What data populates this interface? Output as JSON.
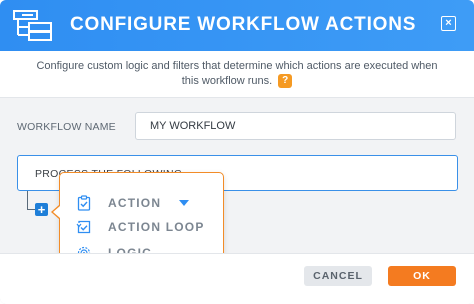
{
  "dialog": {
    "title": "CONFIGURE WORKFLOW ACTIONS",
    "header_icon": "workflow-icon",
    "close_icon": "close-icon",
    "close_symbol": "×"
  },
  "description": {
    "line1": "Configure custom logic and filters that determine which actions are executed when",
    "line2": "this workflow runs.",
    "help_symbol": "?"
  },
  "form": {
    "workflow_name_label": "WORKFLOW NAME",
    "workflow_name_value": "MY WORKFLOW"
  },
  "process": {
    "label": "PROCESS THE FOLLOWING",
    "add_symbol": "+"
  },
  "menu": {
    "items": [
      {
        "label": "ACTION",
        "icon": "clipboard-check-icon"
      },
      {
        "label": "ACTION LOOP",
        "icon": "loop-check-icon"
      },
      {
        "label": "LOGIC",
        "icon": "logic-gear-icon"
      }
    ]
  },
  "footer": {
    "cancel_label": "CANCEL",
    "ok_label": "OK"
  },
  "colors": {
    "header_blue": "#2f8ef2",
    "accent_orange": "#f28c28",
    "ok_orange": "#f47b20",
    "help_orange": "#f59a23",
    "add_blue": "#1e7ed8"
  }
}
